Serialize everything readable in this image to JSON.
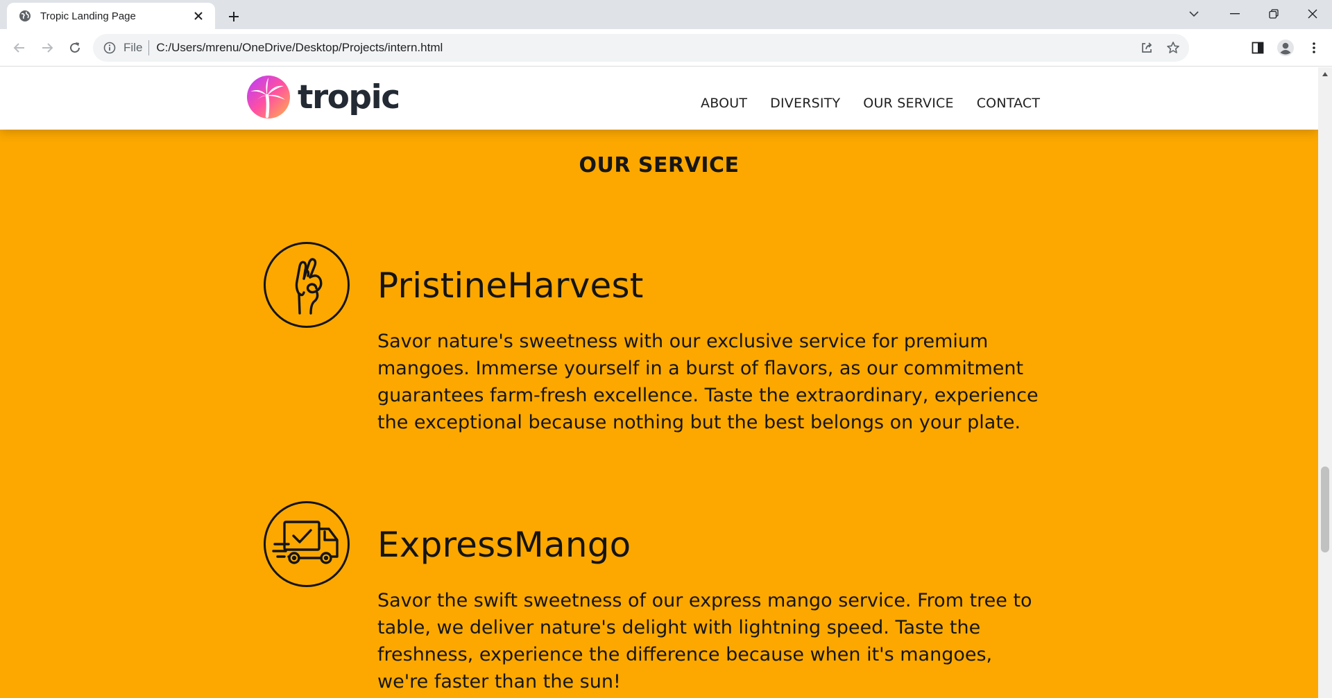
{
  "browser": {
    "tab_title": "Tropic Landing Page",
    "address_scheme": "File",
    "address_url": "C:/Users/mrenu/OneDrive/Desktop/Projects/intern.html"
  },
  "site": {
    "logo_text": "tropic",
    "nav": [
      "ABOUT",
      "DIVERSITY",
      "OUR SERVICE",
      "CONTACT"
    ]
  },
  "section": {
    "title": "OUR SERVICE",
    "services": [
      {
        "icon": "ok-hand-icon",
        "name": "PristineHarvest",
        "description": "Savor nature's sweetness with our exclusive service for premium mangoes. Immerse yourself in a burst of flavors, as our commitment guarantees farm-fresh excellence. Taste the extraordinary, experience the exceptional because nothing but the best belongs on your plate."
      },
      {
        "icon": "delivery-truck-icon",
        "name": "ExpressMango",
        "description": "Savor the swift sweetness of our express mango service. From tree to table, we deliver nature's delight with lightning speed. Taste the freshness, experience the difference because when it's mangoes, we're faster than the sun!"
      }
    ]
  },
  "colors": {
    "page_background": "#fca800",
    "header_background": "#ffffff",
    "text": "#141414"
  }
}
